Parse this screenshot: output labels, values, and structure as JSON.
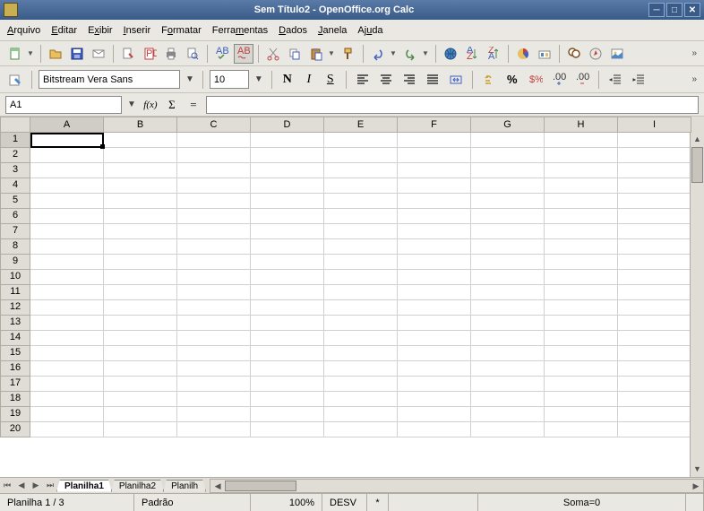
{
  "title": "Sem Título2 - OpenOffice.org Calc",
  "menu": {
    "arquivo": "Arquivo",
    "editar": "Editar",
    "exibir": "Exibir",
    "inserir": "Inserir",
    "formatar": "Formatar",
    "ferramentas": "Ferramentas",
    "dados": "Dados",
    "janela": "Janela",
    "ajuda": "Ajuda"
  },
  "font": {
    "name": "Bitstream Vera Sans",
    "size": "10"
  },
  "fmt": {
    "bold": "N",
    "italic": "I",
    "underline": "S"
  },
  "namebox": "A1",
  "fx": "f(x)",
  "sigma": "Σ",
  "eq": "=",
  "columns": [
    "A",
    "B",
    "C",
    "D",
    "E",
    "F",
    "G",
    "H",
    "I"
  ],
  "rows": [
    "1",
    "2",
    "3",
    "4",
    "5",
    "6",
    "7",
    "8",
    "9",
    "10",
    "11",
    "12",
    "13",
    "14",
    "15",
    "16",
    "17",
    "18",
    "19",
    "20"
  ],
  "active_cell": {
    "row": 0,
    "col": 0
  },
  "tabs": [
    "Planilha1",
    "Planilha2",
    "Planilh"
  ],
  "active_tab": 0,
  "status": {
    "sheet": "Planilha 1 / 3",
    "style": "Padrão",
    "zoom": "100%",
    "mode": "DESV",
    "mod": "*",
    "sum": "Soma=0"
  }
}
